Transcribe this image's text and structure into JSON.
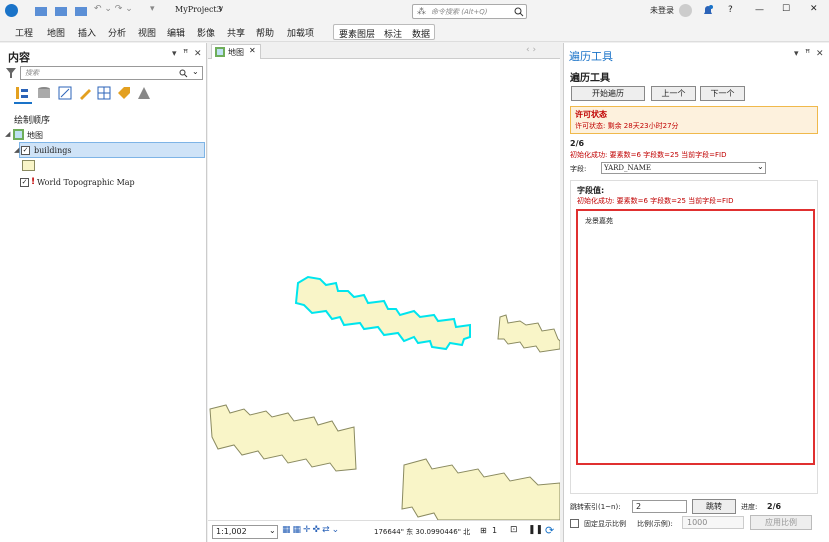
{
  "titlebar": {
    "project": "MyProject3",
    "project_arrow": "∨",
    "search_placeholder": "命令搜索 (Alt+Q)",
    "login": "未登录",
    "help": "?",
    "minimize": "—",
    "maximize": "☐",
    "close": "✕"
  },
  "ribbon": {
    "tabs": [
      "工程",
      "地图",
      "插入",
      "分析",
      "视图",
      "编辑",
      "影像",
      "共享",
      "帮助",
      "加载项"
    ],
    "context_tabs": [
      "要素图层",
      "标注",
      "数据"
    ]
  },
  "contents": {
    "title": "内容",
    "search_placeholder": "搜索",
    "section": "绘制顺序",
    "map_name": "地图",
    "layer1": "buildings",
    "layer2": "World Topographic Map",
    "pin": "ꟸ",
    "close": "✕",
    "menu": "▾"
  },
  "map": {
    "tab": "地图",
    "tab_close": "✕",
    "scale": "1:1,002",
    "coords": "176644\" 东  30.0990446\" 北",
    "selected_count": "1",
    "nav": "‹ ›"
  },
  "tool": {
    "pane_title": "遍历工具",
    "heading": "遍历工具",
    "btn_start": "开始遍历",
    "btn_prev": "上一个",
    "btn_next": "下一个",
    "license_title": "许可状态",
    "license_text": "许可状态: 剩余 28天23小时27分",
    "progress": "2/6",
    "init_msg": "初始化成功: 要素数=6 字段数=25 当前字段=FID",
    "field_label": "字段:",
    "field_value": "YARD_NAME",
    "fieldval_label": "字段值:",
    "init_msg2": "初始化成功: 要素数=6 字段数=25 当前字段=FID",
    "value_text": "龙景嘉苑",
    "jump_label": "跳转索引(1~n):",
    "jump_value": "2",
    "jump_btn": "跳转",
    "progress_label": "进度:",
    "progress_value": "2/6",
    "fix_scale_label": "固定显示比例",
    "scale_label": "比例(示例):",
    "scale_value": "1000",
    "apply_btn": "应用比例"
  },
  "colors": {
    "selection": "#00e5ee",
    "feature_fill": "#f9f5c8",
    "feature_stroke": "#8a8a60",
    "accent": "#1a73c8",
    "license_border": "#f0b94b",
    "highlight": "#e03030"
  }
}
